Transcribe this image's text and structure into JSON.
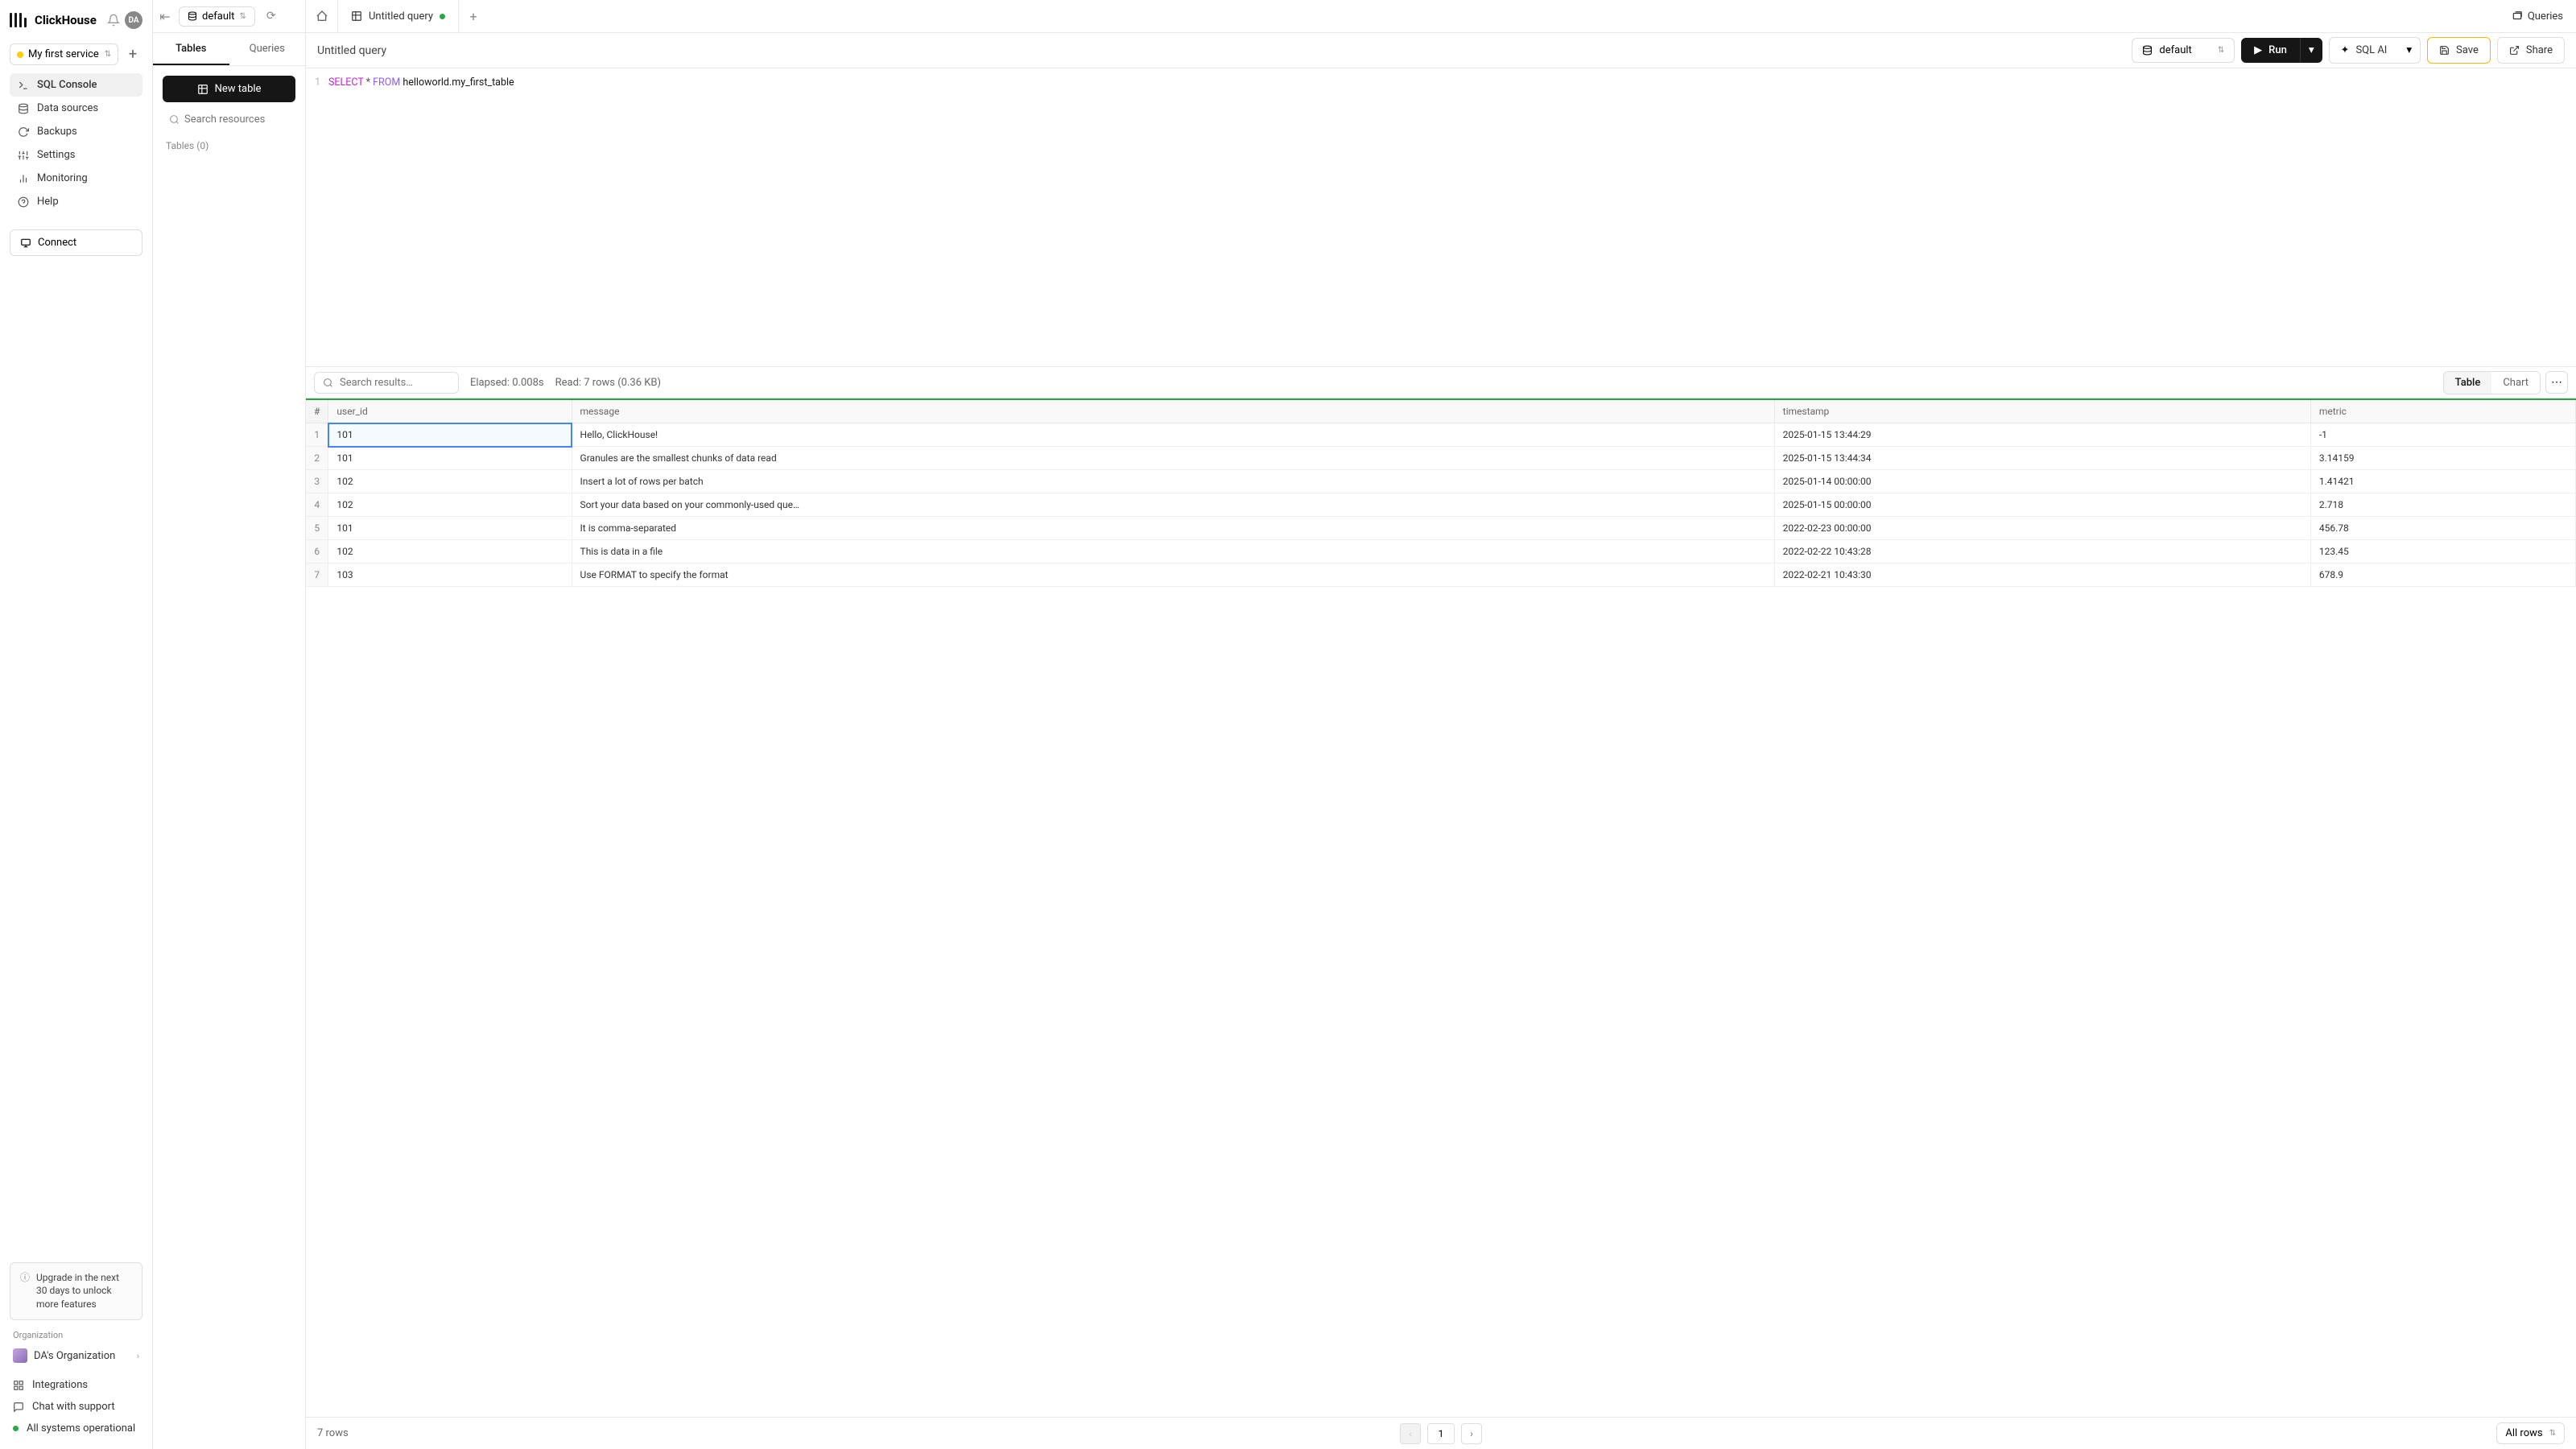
{
  "brand": "ClickHouse",
  "avatar_text": "DA",
  "service_selector": {
    "label": "My first service"
  },
  "sidebar": {
    "items": [
      {
        "label": "SQL Console",
        "icon": "terminal-icon",
        "active": true
      },
      {
        "label": "Data sources",
        "icon": "database-icon"
      },
      {
        "label": "Backups",
        "icon": "refresh-icon"
      },
      {
        "label": "Settings",
        "icon": "settings-icon"
      },
      {
        "label": "Monitoring",
        "icon": "chart-icon"
      },
      {
        "label": "Help",
        "icon": "help-icon"
      }
    ],
    "connect_label": "Connect"
  },
  "upgrade_card": "Upgrade in the next 30 days to unlock more features",
  "org_label": "Organization",
  "org_name": "DA's Organization",
  "bottom_nav": [
    {
      "label": "Integrations",
      "icon": "link-icon"
    },
    {
      "label": "Chat with support",
      "icon": "chat-icon"
    },
    {
      "label": "All systems operational",
      "icon": "status-dot"
    }
  ],
  "panel": {
    "db_label": "default",
    "tabs": [
      {
        "label": "Tables",
        "active": true
      },
      {
        "label": "Queries"
      }
    ],
    "new_table_label": "New table",
    "search_placeholder": "Search resources",
    "tables_count": "Tables (0)"
  },
  "tabs": {
    "query_tab_label": "Untitled query",
    "queries_link": "Queries"
  },
  "query_toolbar": {
    "title": "Untitled query",
    "db_select": "default",
    "run": "Run",
    "sqlai": "SQL AI",
    "save": "Save",
    "share": "Share"
  },
  "editor": {
    "line_number": "1",
    "sql": {
      "select": "SELECT",
      "star": " * ",
      "from": "FROM",
      "table": " helloworld.my_first_table"
    }
  },
  "results_toolbar": {
    "search_placeholder": "Search results…",
    "elapsed": "Elapsed: 0.008s",
    "read": "Read: 7 rows (0.36 KB)",
    "view_table": "Table",
    "view_chart": "Chart"
  },
  "results": {
    "columns": [
      "#",
      "user_id",
      "message",
      "timestamp",
      "metric"
    ],
    "rows": [
      [
        "1",
        "101",
        "Hello, ClickHouse!",
        "2025-01-15 13:44:29",
        "-1"
      ],
      [
        "2",
        "101",
        "Granules are the smallest chunks of data read",
        "2025-01-15 13:44:34",
        "3.14159"
      ],
      [
        "3",
        "102",
        "Insert a lot of rows per batch",
        "2025-01-14 00:00:00",
        "1.41421"
      ],
      [
        "4",
        "102",
        "Sort your data based on your commonly-used que…",
        "2025-01-15 00:00:00",
        "2.718"
      ],
      [
        "5",
        "101",
        "It is comma-separated",
        "2022-02-23 00:00:00",
        "456.78"
      ],
      [
        "6",
        "102",
        "This is data in a file",
        "2022-02-22 10:43:28",
        "123.45"
      ],
      [
        "7",
        "103",
        "Use FORMAT to specify the format",
        "2022-02-21 10:43:30",
        "678.9"
      ]
    ],
    "selected_cell": [
      0,
      1
    ]
  },
  "footer": {
    "row_count": "7 rows",
    "page": "1",
    "rows_select": "All rows"
  }
}
